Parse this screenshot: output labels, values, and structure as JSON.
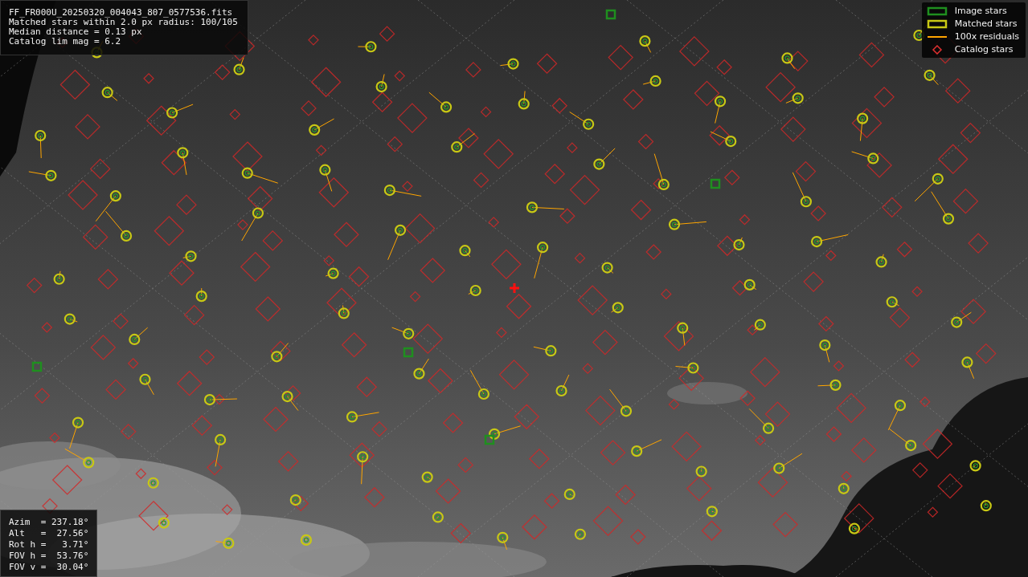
{
  "info_lines": [
    "FF_FR000U_20250320_004043_807_0577536.fits",
    "Matched stars within 2.0 px radius: 100/105",
    "Median distance = 0.13 px",
    "Catalog lim mag = 6.2"
  ],
  "legend": [
    {
      "label": "Image stars",
      "color": "#1f8f1f"
    },
    {
      "kind": "matched",
      "label": "Matched stars",
      "color": "#c8c814"
    },
    {
      "kind": "residual",
      "label": "100x residuals",
      "color": "#ffa500"
    },
    {
      "kind": "catalog",
      "label": "Catalog stars",
      "color": "#e03030"
    }
  ],
  "pointing": [
    "Azim  = 237.18°",
    "Alt   =  27.56°",
    "Rot h =   3.71°",
    "FOV h =  53.76°",
    "FOV v =  30.04°"
  ]
}
